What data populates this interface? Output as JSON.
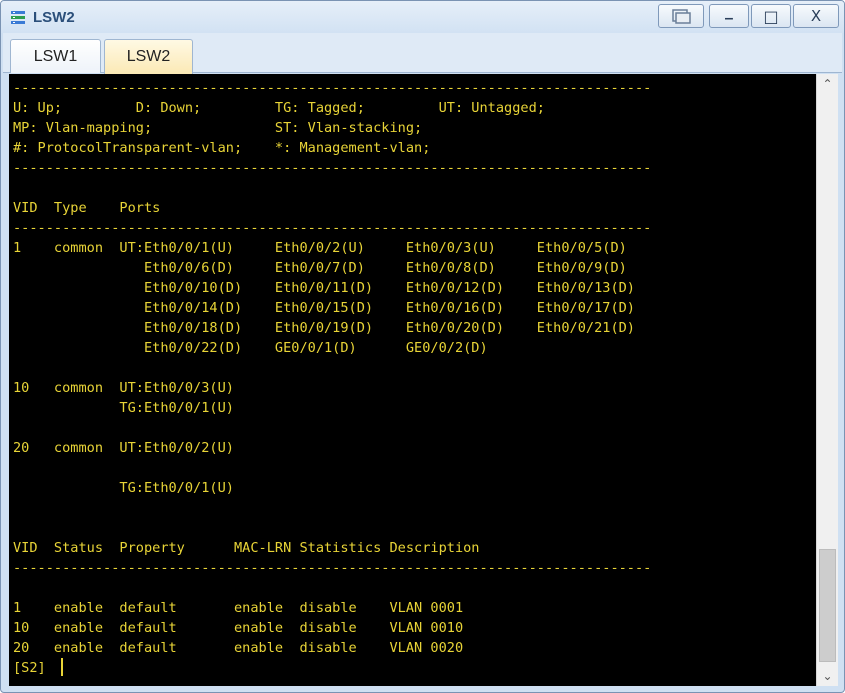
{
  "window": {
    "title": "LSW2"
  },
  "window_controls": {
    "minimize": "–",
    "maximize": "□",
    "close": "X"
  },
  "tabs": [
    {
      "label": "LSW1"
    },
    {
      "label": "LSW2"
    }
  ],
  "terminal": {
    "lines": [
      "------------------------------------------------------------------------------",
      "U: Up;         D: Down;         TG: Tagged;         UT: Untagged;",
      "MP: Vlan-mapping;               ST: Vlan-stacking;",
      "#: ProtocolTransparent-vlan;    *: Management-vlan;",
      "------------------------------------------------------------------------------",
      "",
      "VID  Type    Ports",
      "------------------------------------------------------------------------------",
      "1    common  UT:Eth0/0/1(U)     Eth0/0/2(U)     Eth0/0/3(U)     Eth0/0/5(D)",
      "                Eth0/0/6(D)     Eth0/0/7(D)     Eth0/0/8(D)     Eth0/0/9(D)",
      "                Eth0/0/10(D)    Eth0/0/11(D)    Eth0/0/12(D)    Eth0/0/13(D)",
      "                Eth0/0/14(D)    Eth0/0/15(D)    Eth0/0/16(D)    Eth0/0/17(D)",
      "                Eth0/0/18(D)    Eth0/0/19(D)    Eth0/0/20(D)    Eth0/0/21(D)",
      "                Eth0/0/22(D)    GE0/0/1(D)      GE0/0/2(D)",
      "",
      "10   common  UT:Eth0/0/3(U)",
      "             TG:Eth0/0/1(U)",
      "",
      "20   common  UT:Eth0/0/2(U)",
      "",
      "             TG:Eth0/0/1(U)",
      "",
      "",
      "VID  Status  Property      MAC-LRN Statistics Description",
      "------------------------------------------------------------------------------",
      "",
      "1    enable  default       enable  disable    VLAN 0001",
      "10   enable  default       enable  disable    VLAN 0010",
      "20   enable  default       enable  disable    VLAN 0020",
      "[S2]"
    ]
  }
}
